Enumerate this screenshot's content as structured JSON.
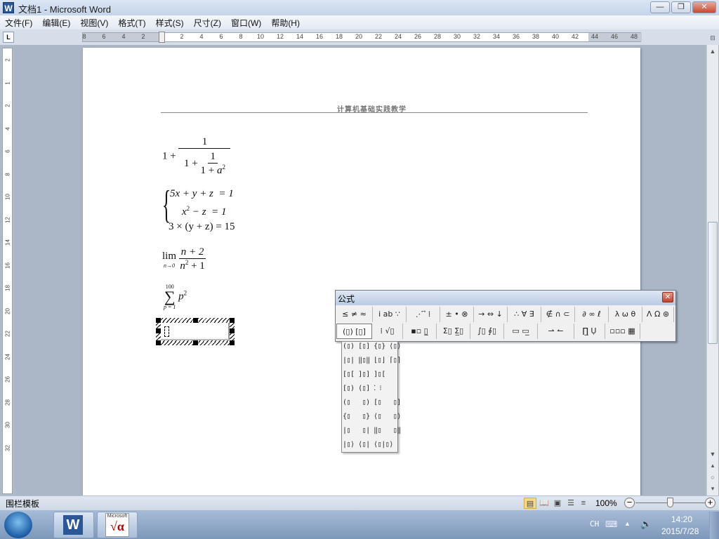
{
  "window": {
    "title": "文档1 - Microsoft Word",
    "controls": {
      "minimize": "—",
      "maximize": "❐",
      "close": "✕"
    }
  },
  "menu": [
    "文件(F)",
    "编辑(E)",
    "视图(V)",
    "格式(T)",
    "样式(S)",
    "尺寸(Z)",
    "窗口(W)",
    "帮助(H)"
  ],
  "ruler": {
    "tab_selector": "L",
    "h_left": [
      "8",
      "6",
      "4",
      "2"
    ],
    "h_right": [
      "2",
      "4",
      "6",
      "8",
      "10",
      "12",
      "14",
      "16",
      "18",
      "20",
      "22",
      "24",
      "26",
      "28",
      "30",
      "32",
      "34",
      "36",
      "38",
      "40",
      "42",
      "44",
      "46",
      "48"
    ],
    "v": [
      "2",
      "1",
      "2",
      "4",
      "6",
      "8",
      "10",
      "12",
      "14",
      "16",
      "18",
      "20",
      "22",
      "24",
      "26",
      "28",
      "30",
      "32"
    ]
  },
  "page": {
    "header": "计算机基础实践教学",
    "eq1": {
      "a": "1 +",
      "num": "1",
      "den_a": "1 +",
      "inner_num": "1",
      "inner_den": "1 + ",
      "var": "a",
      "exp": "2"
    },
    "eq2": {
      "brace": "{",
      "r1": "5x + y + z  = 1",
      "r2a": "x",
      "r2exp": "2",
      "r2b": " − z  = 1",
      "r3": "3 × (y + z) = 15"
    },
    "eq3": {
      "lim": "lim",
      "sub": "n→0",
      "num": "n + 2",
      "den": "n",
      "den_exp": "2",
      "den_b": " + 1"
    },
    "eq4": {
      "top": "100",
      "sigma": "∑",
      "bottom": "p = 1",
      "var": "p",
      "exp": "2"
    }
  },
  "equation_toolbar": {
    "title": "公式",
    "close": "✕",
    "row1": [
      "≤ ≠ ≈",
      "ⅰ ab ∵",
      "⋰ ⃗ ⁞",
      "± • ⊗",
      "→ ⇔ ↓",
      "∴ ∀ ∃",
      "∉ ∩ ⊂",
      "∂ ∞ ℓ",
      "λ ω θ",
      "Λ Ω ⊛"
    ],
    "row2": [
      "(▯) [▯]",
      "⁞ √▯",
      "▪▫ ▯̲",
      "Σ▯ Σ̲▯",
      "∫▯ ∮▯",
      "▭ ▭̲",
      "⇀ ↼",
      "∏̲ Ụ",
      "▫▫▫ ▦"
    ],
    "brackets_palette": [
      "(▯) [▯] {▯} ⟨▯⟩",
      "|▯| ‖▯‖ ⌊▯⌋ ⌈▯⌉",
      "[▯[ ]▯] ]▯[",
      "[▯) (▯] ⁚ ⁝",
      "(▯   ▯) [▯   ▯]",
      "{▯   ▯} ⟨▯   ▯⟩",
      "|▯   ▯| ‖▯   ▯‖",
      "|▯⟩ ⟨▯| ⟨▯|▯⟩"
    ]
  },
  "statusbar": {
    "text": "围栏模板",
    "zoom": "100%",
    "zoom_level_percent": 100,
    "views": [
      "▤",
      "📖",
      "▣",
      "☰",
      "≡"
    ]
  },
  "taskbar": {
    "eq_app_label": "Microsoft",
    "eq_app_glyph": "√α",
    "word_glyph": "W",
    "lang": "CH",
    "keyboard": "⌨",
    "tray_up": "▲",
    "volume": "🔈",
    "time": "14:20",
    "date": "2015/7/28"
  }
}
